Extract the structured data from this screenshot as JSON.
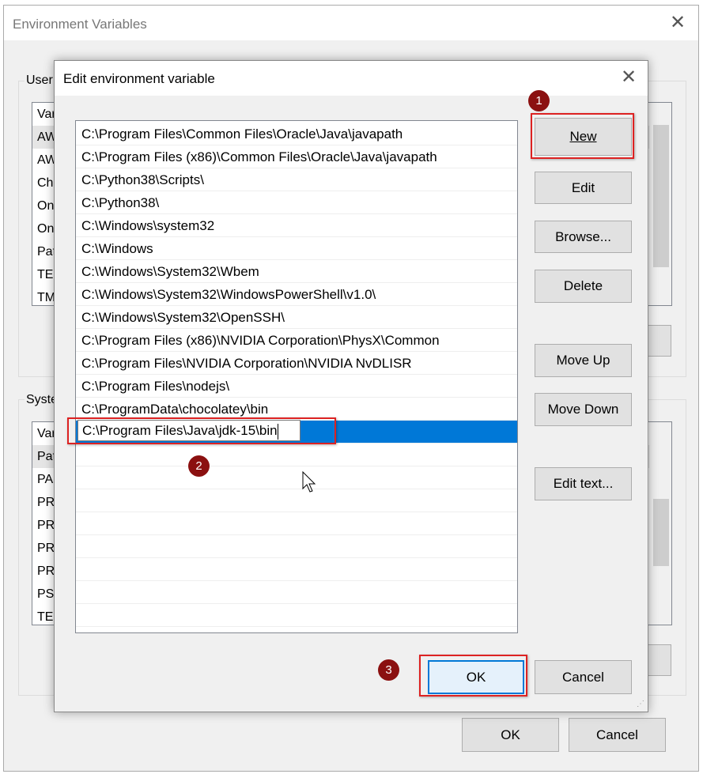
{
  "outer_window": {
    "title": "Environment Variables",
    "user_group_label": "User",
    "system_group_label": "Syste",
    "user_vars": [
      "Var",
      "AW",
      "AW",
      "Ch",
      "On",
      "On",
      "Pat",
      "TEI",
      "TM"
    ],
    "system_vars": [
      "Var",
      "Pat",
      "PA",
      "PR",
      "PR",
      "PR",
      "PR",
      "PS",
      "TEI"
    ],
    "ok_label": "OK",
    "cancel_label": "Cancel"
  },
  "dialog": {
    "title": "Edit environment variable",
    "paths": [
      "C:\\Program Files\\Common Files\\Oracle\\Java\\javapath",
      "C:\\Program Files (x86)\\Common Files\\Oracle\\Java\\javapath",
      "C:\\Python38\\Scripts\\",
      "C:\\Python38\\",
      "C:\\Windows\\system32",
      "C:\\Windows",
      "C:\\Windows\\System32\\Wbem",
      "C:\\Windows\\System32\\WindowsPowerShell\\v1.0\\",
      "C:\\Windows\\System32\\OpenSSH\\",
      "C:\\Program Files (x86)\\NVIDIA Corporation\\PhysX\\Common",
      "C:\\Program Files\\NVIDIA Corporation\\NVIDIA NvDLISR",
      "C:\\Program Files\\nodejs\\",
      "C:\\ProgramData\\chocolatey\\bin"
    ],
    "editing_value": "C:\\Program Files\\Java\\jdk-15\\bin",
    "buttons": {
      "new": "New",
      "edit": "Edit",
      "browse": "Browse...",
      "delete": "Delete",
      "move_up": "Move Up",
      "move_down": "Move Down",
      "edit_text": "Edit text...",
      "ok": "OK",
      "cancel": "Cancel"
    }
  },
  "annotations": [
    "1",
    "2",
    "3"
  ],
  "colors": {
    "selection": "#0078d7",
    "highlight_box": "#dd2222",
    "badge": "#8b1010"
  }
}
